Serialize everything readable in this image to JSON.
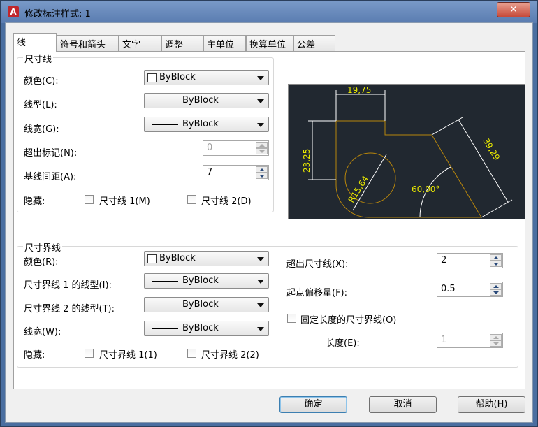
{
  "title": "修改标注样式: 1",
  "tabs": [
    "线",
    "符号和箭头",
    "文字",
    "调整",
    "主单位",
    "换算单位",
    "公差"
  ],
  "dim_lines": {
    "title": "尺寸线",
    "color_label": "颜色(C):",
    "color_value": "ByBlock",
    "linetype_label": "线型(L):",
    "linetype_value": "ByBlock",
    "lineweight_label": "线宽(G):",
    "lineweight_value": "ByBlock",
    "extend_label": "超出标记(N):",
    "extend_value": "0",
    "baseline_label": "基线间距(A):",
    "baseline_value": "7",
    "suppress_label": "隐藏:",
    "suppress1": "尺寸线 1(M)",
    "suppress2": "尺寸线 2(D)"
  },
  "ext_lines": {
    "title": "尺寸界线",
    "color_label": "颜色(R):",
    "color_value": "ByBlock",
    "lt1_label": "尺寸界线 1 的线型(I):",
    "lt1_value": "ByBlock",
    "lt2_label": "尺寸界线 2 的线型(T):",
    "lt2_value": "ByBlock",
    "lw_label": "线宽(W):",
    "lw_value": "ByBlock",
    "suppress_label": "隐藏:",
    "suppress1": "尺寸界线 1(1)",
    "suppress2": "尺寸界线 2(2)",
    "beyond_label": "超出尺寸线(X):",
    "beyond_value": "2",
    "offset_label": "起点偏移量(F):",
    "offset_value": "0.5",
    "fixed_label": "固定长度的尺寸界线(O)",
    "length_label": "长度(E):",
    "length_value": "1"
  },
  "preview": {
    "dim_top": "19,75",
    "dim_left": "23,25",
    "dim_right": "39,29",
    "dim_radius": "R15,64",
    "dim_angle": "60,00°",
    "line_color": "#b8860b",
    "text_color": "#e8e800"
  },
  "buttons": {
    "ok": "确定",
    "cancel": "取消",
    "help": "帮助(H)"
  }
}
